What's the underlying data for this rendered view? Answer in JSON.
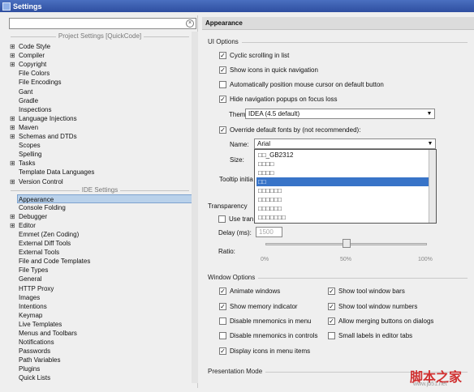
{
  "window": {
    "title": "Settings"
  },
  "left": {
    "project_header": "Project Settings [QuickCode]",
    "ide_header": "IDE Settings",
    "project_items": [
      {
        "label": "Code Style",
        "exp": true
      },
      {
        "label": "Compiler",
        "exp": true
      },
      {
        "label": "Copyright",
        "exp": true
      },
      {
        "label": "File Colors",
        "exp": false
      },
      {
        "label": "File Encodings",
        "exp": false
      },
      {
        "label": "Gant",
        "exp": false
      },
      {
        "label": "Gradle",
        "exp": false
      },
      {
        "label": "Inspections",
        "exp": false
      },
      {
        "label": "Language Injections",
        "exp": true
      },
      {
        "label": "Maven",
        "exp": true
      },
      {
        "label": "Schemas and DTDs",
        "exp": true
      },
      {
        "label": "Scopes",
        "exp": false
      },
      {
        "label": "Spelling",
        "exp": false
      },
      {
        "label": "Tasks",
        "exp": true
      },
      {
        "label": "Template Data Languages",
        "exp": false
      },
      {
        "label": "Version Control",
        "exp": true
      }
    ],
    "ide_items": [
      {
        "label": "Appearance",
        "exp": false,
        "sel": true
      },
      {
        "label": "Console Folding",
        "exp": false
      },
      {
        "label": "Debugger",
        "exp": true
      },
      {
        "label": "Editor",
        "exp": true
      },
      {
        "label": "Emmet (Zen Coding)",
        "exp": false
      },
      {
        "label": "External Diff Tools",
        "exp": false
      },
      {
        "label": "External Tools",
        "exp": false
      },
      {
        "label": "File and Code Templates",
        "exp": false
      },
      {
        "label": "File Types",
        "exp": false
      },
      {
        "label": "General",
        "exp": false
      },
      {
        "label": "HTTP Proxy",
        "exp": false
      },
      {
        "label": "Images",
        "exp": false
      },
      {
        "label": "Intentions",
        "exp": false
      },
      {
        "label": "Keymap",
        "exp": false
      },
      {
        "label": "Live Templates",
        "exp": false
      },
      {
        "label": "Menus and Toolbars",
        "exp": false
      },
      {
        "label": "Notifications",
        "exp": false
      },
      {
        "label": "Passwords",
        "exp": false
      },
      {
        "label": "Path Variables",
        "exp": false
      },
      {
        "label": "Plugins",
        "exp": false
      },
      {
        "label": "Quick Lists",
        "exp": false
      }
    ]
  },
  "main": {
    "header": "Appearance",
    "ui_options": "UI Options",
    "cb": [
      {
        "label": "Cyclic scrolling in list",
        "checked": true
      },
      {
        "label": "Show icons in quick navigation",
        "checked": true
      },
      {
        "label": "Automatically position mouse cursor on default button",
        "checked": false
      },
      {
        "label": "Hide navigation popups on focus loss",
        "checked": true
      }
    ],
    "theme_label": "Theme:",
    "theme_value": "IDEA (4.5 default)",
    "override_label": "Override default fonts by (not recommended):",
    "name_label": "Name:",
    "name_value": "Arial",
    "size_label": "Size:",
    "tooltip_label": "Tooltip initia",
    "font_options": [
      "□□_GB2312",
      "□□□□",
      "□□□□",
      "□□",
      "□□□□□□",
      "□□□□□□",
      "□□□□□□",
      "□□□□□□□"
    ],
    "transparency": "Transparency",
    "use_tran": "Use tran",
    "delay_label": "Delay (ms):",
    "delay_value": "1500",
    "ratio_label": "Ratio:",
    "ratio_value": "50%",
    "ticks": [
      "0%",
      "50%",
      "100%"
    ],
    "window_options": "Window Options",
    "wo_left": [
      {
        "label": "Animate windows",
        "checked": true
      },
      {
        "label": "Show memory indicator",
        "checked": true
      },
      {
        "label": "Disable mnemonics in menu",
        "checked": false
      },
      {
        "label": "Disable mnemonics in controls",
        "checked": false
      },
      {
        "label": "Display icons in menu items",
        "checked": true
      }
    ],
    "wo_right": [
      {
        "label": "Show tool window bars",
        "checked": true
      },
      {
        "label": "Show tool window numbers",
        "checked": true
      },
      {
        "label": "Allow merging buttons on dialogs",
        "checked": true
      },
      {
        "label": "Small labels in editor tabs",
        "checked": false
      }
    ],
    "presentation": "Presentation Mode"
  },
  "watermark": {
    "text": "脚本之家",
    "sub": "www.jb51.net"
  }
}
